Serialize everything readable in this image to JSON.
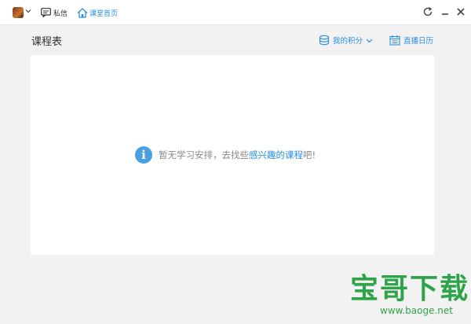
{
  "header": {
    "messages_label": "私信",
    "home_label": "课堂首页"
  },
  "page": {
    "title": "课程表",
    "points_label": "我的积分",
    "calendar_label": "直播日历"
  },
  "empty_state": {
    "text_prefix": "暂无学习安排，去找些",
    "link_text": "感兴趣的课程",
    "text_suffix": "吧!"
  },
  "watermark": {
    "title": "宝哥下载",
    "url": "www.baoge.net"
  },
  "icons": {
    "avatar": "user-avatar",
    "messages": "chat-bubble-icon",
    "home": "home-icon",
    "refresh": "refresh-icon",
    "minimize": "minimize-icon",
    "close": "close-icon",
    "points": "coins-icon",
    "calendar": "calendar-icon",
    "info": "info-icon"
  },
  "colors": {
    "accent": "#2a8fe0",
    "info": "#4a9fe3",
    "watermark": "#2fa34a",
    "background": "#f2f2f2"
  }
}
